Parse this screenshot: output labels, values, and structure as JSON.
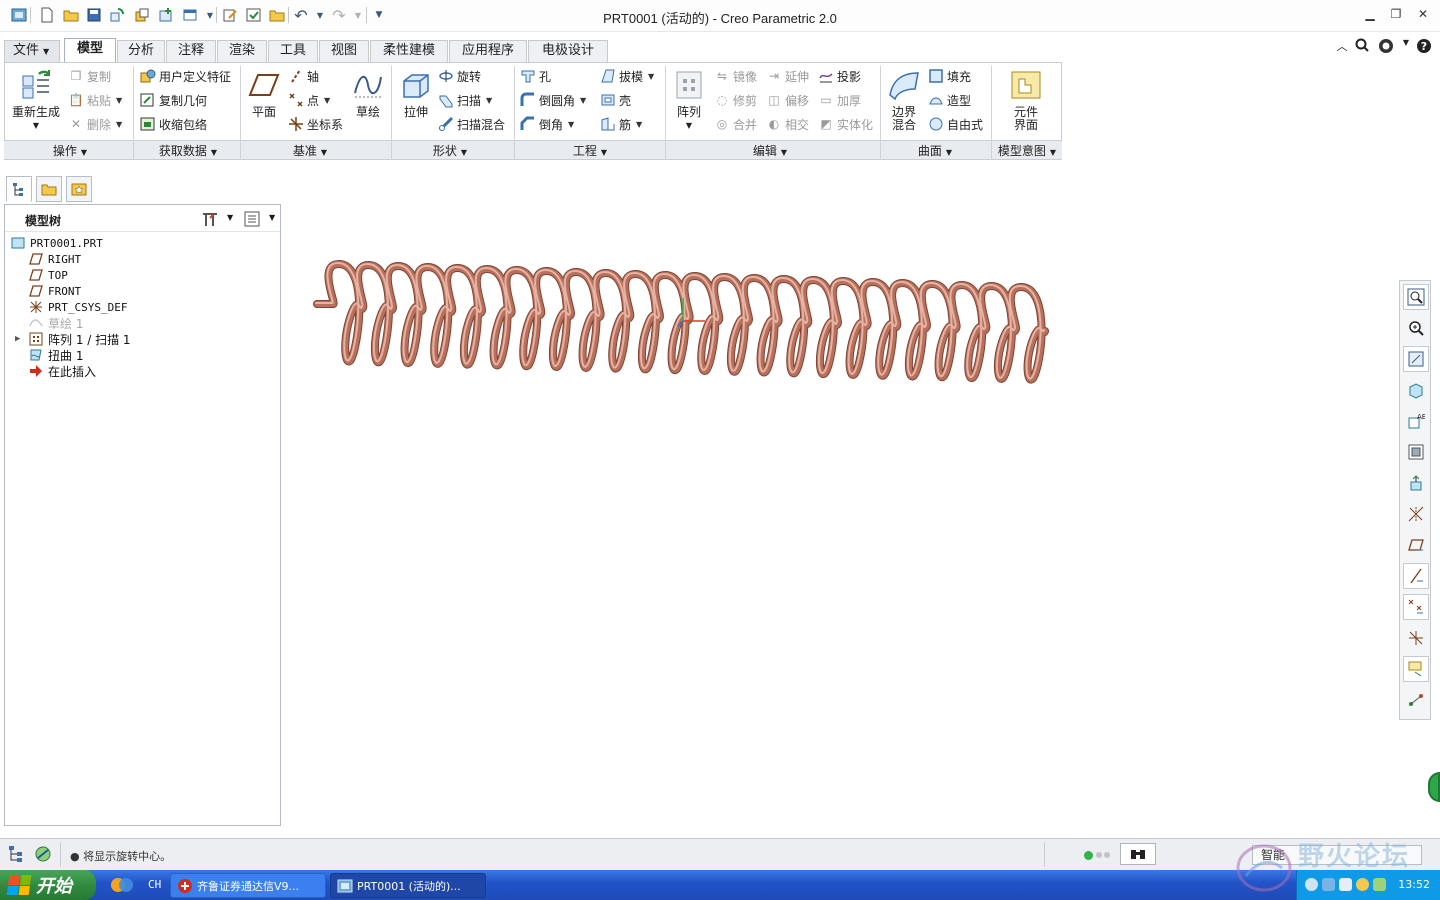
{
  "window": {
    "title": "PRT0001 (活动的) - Creo Parametric 2.0",
    "controls": [
      "minimize",
      "restore",
      "close"
    ]
  },
  "quick_access": [
    "new-icon",
    "open-icon",
    "save-icon",
    "regenerate-icon",
    "copy-icon",
    "windows-icon",
    "window-icon",
    "edit-icon",
    "check-icon",
    "folder-icon",
    "undo-icon",
    "redo-icon",
    "customize-icon"
  ],
  "ribbon": {
    "tabs": [
      {
        "label": "文件",
        "dropdown": true
      },
      {
        "label": "模型",
        "active": true
      },
      {
        "label": "分析"
      },
      {
        "label": "注释"
      },
      {
        "label": "渲染"
      },
      {
        "label": "工具"
      },
      {
        "label": "视图"
      },
      {
        "label": "柔性建模"
      },
      {
        "label": "应用程序"
      },
      {
        "label": "电极设计"
      }
    ],
    "groups": {
      "operations": {
        "label": "操作",
        "regenerate": "重新生成",
        "copy": "复制",
        "paste": "粘贴",
        "delete": "删除"
      },
      "get_data": {
        "label": "获取数据",
        "udf": "用户定义特征",
        "copy_geom": "复制几何",
        "shrinkwrap": "收缩包络"
      },
      "datum": {
        "label": "基准",
        "plane": "平面",
        "axis": "轴",
        "point": "点",
        "csys": "坐标系",
        "sketch": "草绘"
      },
      "shapes": {
        "label": "形状",
        "extrude": "拉伸",
        "revolve": "旋转",
        "sweep": "扫描",
        "swept_blend": "扫描混合"
      },
      "engineering": {
        "label": "工程",
        "hole": "孔",
        "round": "倒圆角",
        "chamfer": "倒角",
        "draft": "拔模",
        "shell": "壳",
        "rib": "筋"
      },
      "editing": {
        "label": "编辑",
        "pattern": "阵列",
        "mirror": "镜像",
        "trim": "修剪",
        "merge": "合并",
        "extend": "延伸",
        "offset": "偏移",
        "intersect": "相交",
        "project": "投影",
        "thicken": "加厚",
        "solidify": "实体化"
      },
      "surfaces": {
        "label": "曲面",
        "boundary_blend_1": "边界",
        "boundary_blend_2": "混合",
        "fill": "填充",
        "style": "造型",
        "freestyle": "自由式"
      },
      "model_intent": {
        "label": "模型意图",
        "component_interface_1": "元件",
        "component_interface_2": "界面"
      }
    }
  },
  "left_panel": {
    "title": "模型树",
    "tree": [
      {
        "label": "PRT0001.PRT",
        "icon": "part-icon"
      },
      {
        "label": "RIGHT",
        "icon": "datum-plane-icon"
      },
      {
        "label": "TOP",
        "icon": "datum-plane-icon"
      },
      {
        "label": "FRONT",
        "icon": "datum-plane-icon"
      },
      {
        "label": "PRT_CSYS_DEF",
        "icon": "csys-icon"
      },
      {
        "label": "草绘 1",
        "icon": "sketch-icon",
        "suppressed": true
      },
      {
        "label": "阵列 1 / 扫描 1",
        "icon": "pattern-icon",
        "expandable": true
      },
      {
        "label": "扭曲 1",
        "icon": "warp-icon"
      },
      {
        "label": "在此插入",
        "icon": "insert-arrow-icon"
      }
    ]
  },
  "graphics": {
    "model": "pattern of looped swept tube",
    "tube_color": "#b8705c",
    "loops": 24
  },
  "status_bar": {
    "message": "● 将显示旋转中心。",
    "selection_filter": "智能"
  },
  "taskbar": {
    "start_label": "开始",
    "lang": "CH",
    "items": [
      {
        "label": "齐鲁证券通达信V9...",
        "active": false
      },
      {
        "label": "PRT0001 (活动的)...",
        "active": true
      }
    ],
    "clock": "13:52"
  },
  "watermark": "野火论坛"
}
